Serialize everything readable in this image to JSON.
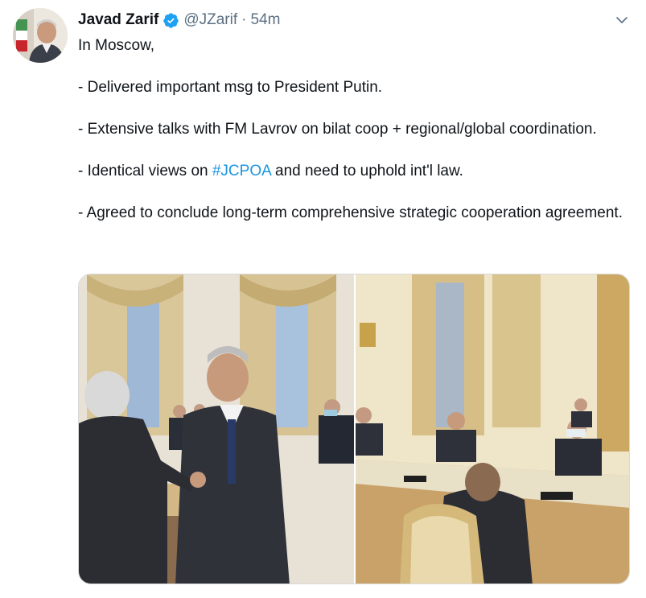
{
  "author": {
    "name": "Javad Zarif",
    "handle": "@JZarif",
    "separator": "·",
    "time": "54m",
    "verified": true,
    "avatar_icon": "profile-photo"
  },
  "menu_icon": "chevron-down-icon",
  "tweet": {
    "line1": "In Moscow,",
    "line2": "- Delivered important msg to President Putin.",
    "line3": "- Extensive talks with FM Lavrov on bilat coop + regional/global coordination.",
    "line4_before": "- Identical views on ",
    "line4_hashtag": "#JCPOA",
    "line4_after": " and need to uphold int'l law.",
    "line5": "- Agreed to conclude long-term comprehensive strategic cooperation agreement."
  },
  "colors": {
    "link": "#1b95e0",
    "secondary_text": "#5b7083",
    "verified_badge": "#1da1f2"
  },
  "media": {
    "photos": [
      "photo-1",
      "photo-2"
    ]
  }
}
